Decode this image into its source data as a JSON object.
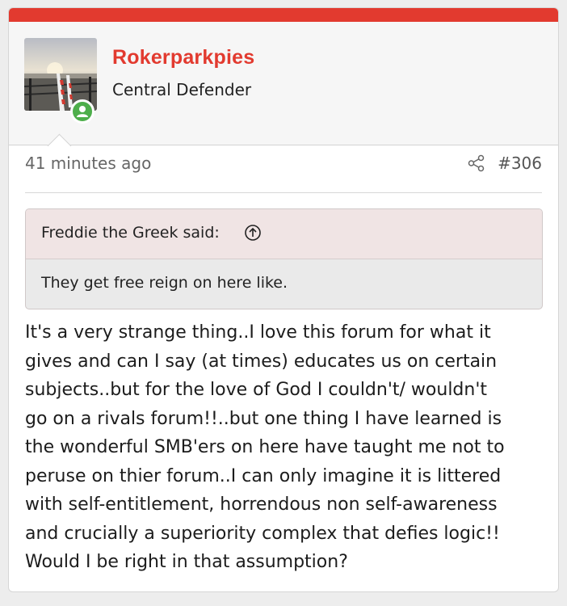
{
  "colors": {
    "accent": "#e23a2f",
    "online": "#4dae4a",
    "quote_header_bg": "#f0e4e4",
    "quote_body_bg": "#eaeaea"
  },
  "author": {
    "username": "Rokerparkpies",
    "title": "Central Defender",
    "avatar_icon": "avatar-photo",
    "online_icon": "user-online-icon"
  },
  "meta": {
    "timestamp": "41 minutes ago",
    "share_icon": "share-icon",
    "post_number": "#306"
  },
  "quote": {
    "author_line": "Freddie the Greek said:",
    "jump_icon": "arrow-up-circle-icon",
    "text": "They get free reign on here like."
  },
  "body": {
    "lines": [
      "It's a very strange thing..I love this forum for what it",
      "gives and can I say (at times) educates us on certain",
      "subjects..but for the love of God I couldn't/ wouldn't",
      "go on a rivals forum!!..but one thing I have learned is",
      "the wonderful SMB'ers on here have taught me not to",
      "peruse on thier forum..I can only imagine it is littered",
      "with self-entitlement, horrendous non self-awareness",
      "and crucially a superiority complex that defies logic!!",
      "Would I be right in that assumption?"
    ]
  }
}
